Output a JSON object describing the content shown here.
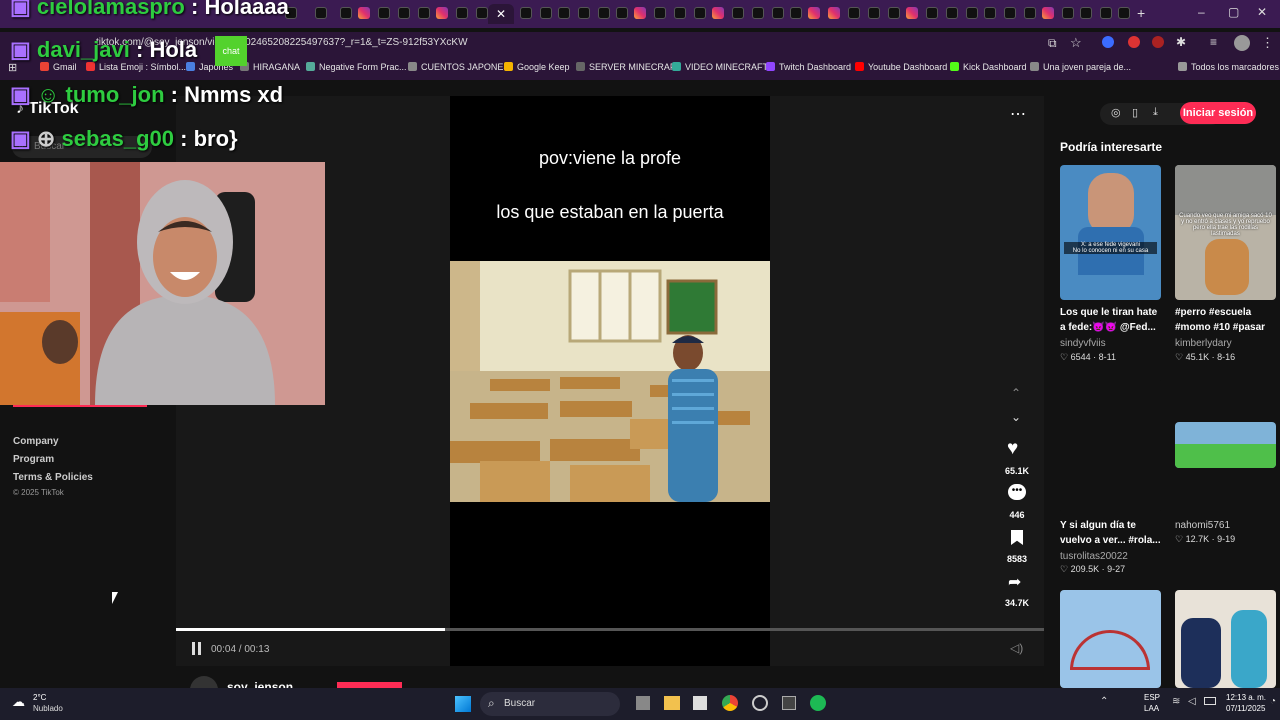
{
  "browser": {
    "url": "tiktok.com/@soy_jenson/video/7502465208225497637?_r=1&_t=ZS-912f53YXcKW",
    "bookmarks": [
      "Gmail",
      "Lista Emoji : Símbol...",
      "Japonés",
      "HIRAGANA",
      "Negative Form Prac...",
      "CUENTOS JAPONES",
      "Google Keep",
      "SERVER MINECRAFT",
      "VIDEO MINECRAFT",
      "Twitch Dashboard",
      "Youtube Dashboard",
      "Kick Dashboard",
      "Una joven pareja de...",
      "Todos los marcadores"
    ]
  },
  "overlay_chat": [
    {
      "user": "cielolamaspro",
      "msg": "Holaaaa"
    },
    {
      "user": "davi_javi",
      "msg": "Hola"
    },
    {
      "user": "tumo_jon",
      "msg": "Nmms xd"
    },
    {
      "user": "sebas_g00",
      "msg": "bro}"
    }
  ],
  "chat_badge": "chat",
  "tiktok": {
    "logo": "TikTok",
    "search_placeholder": "Buscar",
    "login_button": "Iniciar sesión",
    "footer_links": [
      "Company",
      "Program",
      "Terms & Policies"
    ],
    "copyright": "© 2025 TikTok",
    "author": "soy_jenson"
  },
  "video": {
    "caption_top": "pov:viene la profe",
    "caption_bottom": "los que estaban en la puerta",
    "time": "00:04 / 00:13",
    "progress": 0.31,
    "likes": "65.1K",
    "comments": "446",
    "saves": "8583",
    "shares": "34.7K"
  },
  "recommendations": {
    "heading": "Podría interesarte",
    "items": [
      {
        "title": "Los que le tiran hate a fede:👿👿 @Fed...",
        "user": "sindyvfviis",
        "likes": "6544",
        "date": "8-11",
        "overlay": "X: a ese fede vigevani\nNo lo conocen ni en su casa"
      },
      {
        "title": "#perro #escuela #momo #10 #pasar",
        "user": "kimberlydary",
        "likes": "45.1K",
        "date": "8-16",
        "overlay": "Cuando veo que mi amiga sacó 10 y no entró a clases y yo repruebo pero ella trae las rodillas lastimadas"
      },
      {
        "title": "Y si algun día te vuelvo a ver... #rola...",
        "user": "tusrolitas20022",
        "likes": "209.5K",
        "date": "9-27",
        "overlay": ""
      },
      {
        "title": "",
        "user": "nahomi5761",
        "likes": "12.7K",
        "date": "9-19",
        "overlay": ""
      }
    ]
  },
  "taskbar": {
    "temperature": "2°C",
    "weather": "Nublado",
    "search": "Buscar",
    "lang": "ESP",
    "lang2": "LAA",
    "clock": "12:13 a. m.",
    "date": "07/11/2025"
  },
  "colors": {
    "accent": "#fe2c55",
    "chat_name": "#2ecc40",
    "tab_bg": "#3b1b52"
  }
}
